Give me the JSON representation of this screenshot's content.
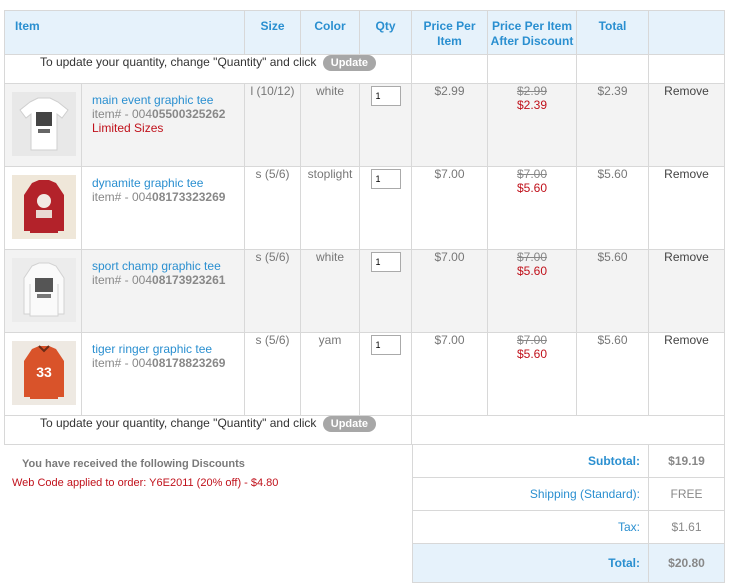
{
  "header": {
    "item": "Item",
    "size": "Size",
    "color": "Color",
    "qty": "Qty",
    "price_per_item": "Price Per Item",
    "price_after_discount": "Price Per Item After Discount",
    "total": "Total"
  },
  "update_notice": {
    "text": "To update your quantity, change \"Quantity\" and click",
    "button": "Update"
  },
  "items": [
    {
      "name": "main event graphic tee",
      "sku_prefix": "item# - 004",
      "sku_bold": "05500325262",
      "note": "Limited Sizes",
      "size": "l (10/12)",
      "color": "white",
      "qty": "1",
      "price": "$2.99",
      "orig_price": "$2.99",
      "disc_price": "$2.39",
      "total": "$2.39",
      "remove": "Remove",
      "thumb_color": "#ffffff",
      "thumb_icon": "white-graphic-tee-image"
    },
    {
      "name": "dynamite graphic tee",
      "sku_prefix": "item# - 004",
      "sku_bold": "08173323269",
      "note": "",
      "size": "s (5/6)",
      "color": "stoplight",
      "qty": "1",
      "price": "$7.00",
      "orig_price": "$7.00",
      "disc_price": "$5.60",
      "total": "$5.60",
      "remove": "Remove",
      "thumb_color": "#b3222a",
      "thumb_icon": "red-longsleeve-tee-image"
    },
    {
      "name": "sport champ graphic tee",
      "sku_prefix": "item# - 004",
      "sku_bold": "08173923261",
      "note": "",
      "size": "s (5/6)",
      "color": "white",
      "qty": "1",
      "price": "$7.00",
      "orig_price": "$7.00",
      "disc_price": "$5.60",
      "total": "$5.60",
      "remove": "Remove",
      "thumb_color": "#f4f4f4",
      "thumb_icon": "white-longsleeve-tee-image"
    },
    {
      "name": "tiger ringer graphic tee",
      "sku_prefix": "item# - 004",
      "sku_bold": "08178823269",
      "note": "",
      "size": "s (5/6)",
      "color": "yam",
      "qty": "1",
      "price": "$7.00",
      "orig_price": "$7.00",
      "disc_price": "$5.60",
      "total": "$5.60",
      "remove": "Remove",
      "thumb_color": "#d9532a",
      "thumb_icon": "orange-ringer-tee-image"
    }
  ],
  "discounts": {
    "title": "You have received the following Discounts",
    "code_line": "Web Code applied to order: Y6E2011 (20% off) - $4.80"
  },
  "totals": {
    "subtotal_label": "Subtotal:",
    "subtotal": "$19.19",
    "shipping_label": "Shipping (Standard):",
    "shipping": "FREE",
    "tax_label": "Tax:",
    "tax": "$1.61",
    "total_label": "Total:",
    "total": "$20.80"
  },
  "colors": {
    "accent": "#2a8fd0",
    "header_bg": "#e6f2fb",
    "discount_red": "#c0111b",
    "button_gray": "#a7a7a7"
  }
}
